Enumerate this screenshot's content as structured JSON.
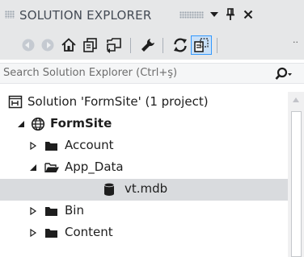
{
  "panel": {
    "title": "SOLUTION EXPLORER"
  },
  "title_buttons": {
    "dropdown_icon": "dropdown-arrow-icon",
    "pin_icon": "pin-icon",
    "close_icon": "close-icon"
  },
  "toolbar": {
    "buttons": [
      {
        "name": "back",
        "icon": "back-arrow-icon",
        "enabled": false
      },
      {
        "name": "forward",
        "icon": "forward-arrow-icon",
        "enabled": false
      },
      {
        "name": "home",
        "icon": "home-icon",
        "enabled": true
      },
      {
        "name": "pending-changes-filter",
        "icon": "pending-changes-icon",
        "enabled": true
      },
      {
        "name": "sync-with-active-document",
        "icon": "sync-icon",
        "enabled": true
      },
      {
        "name": "properties",
        "icon": "wrench-icon",
        "enabled": true
      },
      {
        "name": "refresh",
        "icon": "refresh-icon",
        "enabled": true
      },
      {
        "name": "show-all-files",
        "icon": "show-all-files-icon",
        "enabled": true,
        "active": true
      }
    ],
    "overflow_icon": "toolbar-overflow-icon"
  },
  "search": {
    "placeholder": "Search Solution Explorer (Ctrl+ş)"
  },
  "tree": {
    "items": [
      {
        "label": "Solution 'FormSite' (1 project)",
        "icon": "solution-icon",
        "expand_state": "none"
      },
      {
        "label": "FormSite",
        "icon": "globe-icon",
        "expand_state": "expanded",
        "bold": true
      },
      {
        "label": "Account",
        "icon": "folder-icon",
        "expand_state": "collapsed"
      },
      {
        "label": "App_Data",
        "icon": "folder-open-icon",
        "expand_state": "expanded"
      },
      {
        "label": "vt.mdb",
        "icon": "database-icon",
        "expand_state": "none",
        "selected": true
      },
      {
        "label": "Bin",
        "icon": "folder-icon",
        "expand_state": "collapsed"
      },
      {
        "label": "Content",
        "icon": "folder-icon",
        "expand_state": "collapsed"
      }
    ]
  },
  "colors": {
    "panel_background": "#e6e7e8",
    "selection": "#d9dbde",
    "active_button_border": "#3399ff"
  }
}
